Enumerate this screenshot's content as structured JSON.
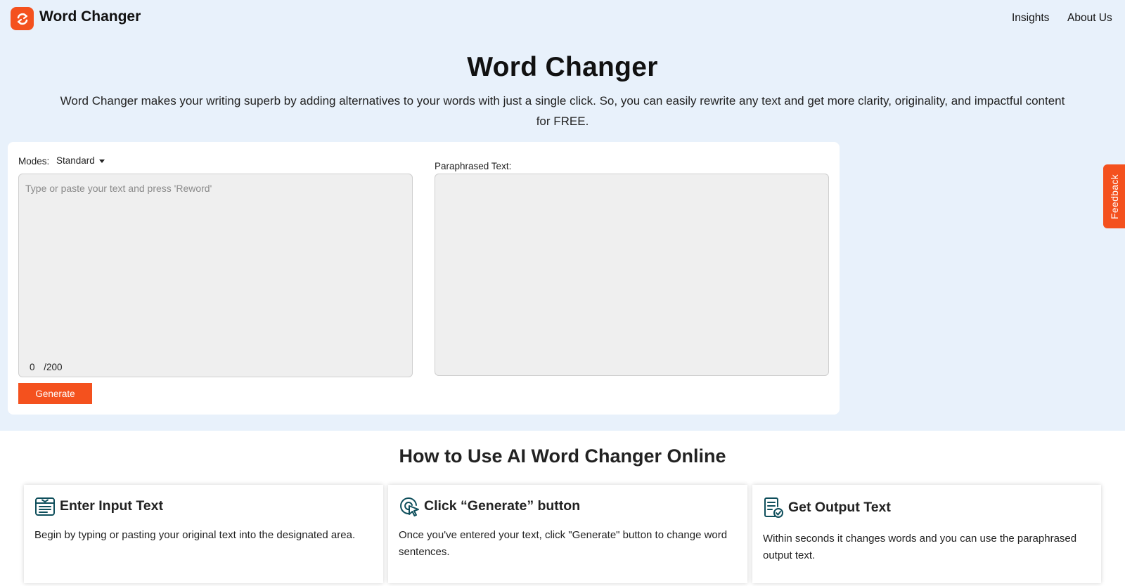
{
  "header": {
    "brand_name": "Word Changer",
    "nav": [
      "Insights",
      "About Us"
    ]
  },
  "hero": {
    "title": "Word Changer",
    "subtitle": "Word Changer makes your writing superb by adding alternatives to your words with just a single click. So, you can easily rewrite any text and get more clarity, originality, and impactful content for FREE."
  },
  "tool": {
    "modes_label": "Modes:",
    "mode_selected": "Standard",
    "input_placeholder": "Type or paste your text and press 'Reword'",
    "input_value": "",
    "char_count": "0",
    "char_limit": "/200",
    "output_label": "Paraphrased Text:",
    "generate_label": "Generate"
  },
  "feedback": {
    "label": "Feedback"
  },
  "howto": {
    "title": "How to Use AI Word Changer Online",
    "steps": [
      {
        "icon": "input-text-icon",
        "title": "Enter Input Text",
        "desc": "Begin by typing or pasting your original text into the designated area."
      },
      {
        "icon": "click-cursor-icon",
        "title": "Click “Generate” button",
        "desc": "Once you've entered your text, click \"Generate\" button to change word sentences."
      },
      {
        "icon": "document-check-icon",
        "title": "Get Output Text",
        "desc": "Within seconds it changes words and you can use the paraphrased output text."
      }
    ]
  },
  "colors": {
    "accent": "#f4511e",
    "hero_bg": "#e8f1fb",
    "icon_teal": "#0f4f5c"
  }
}
